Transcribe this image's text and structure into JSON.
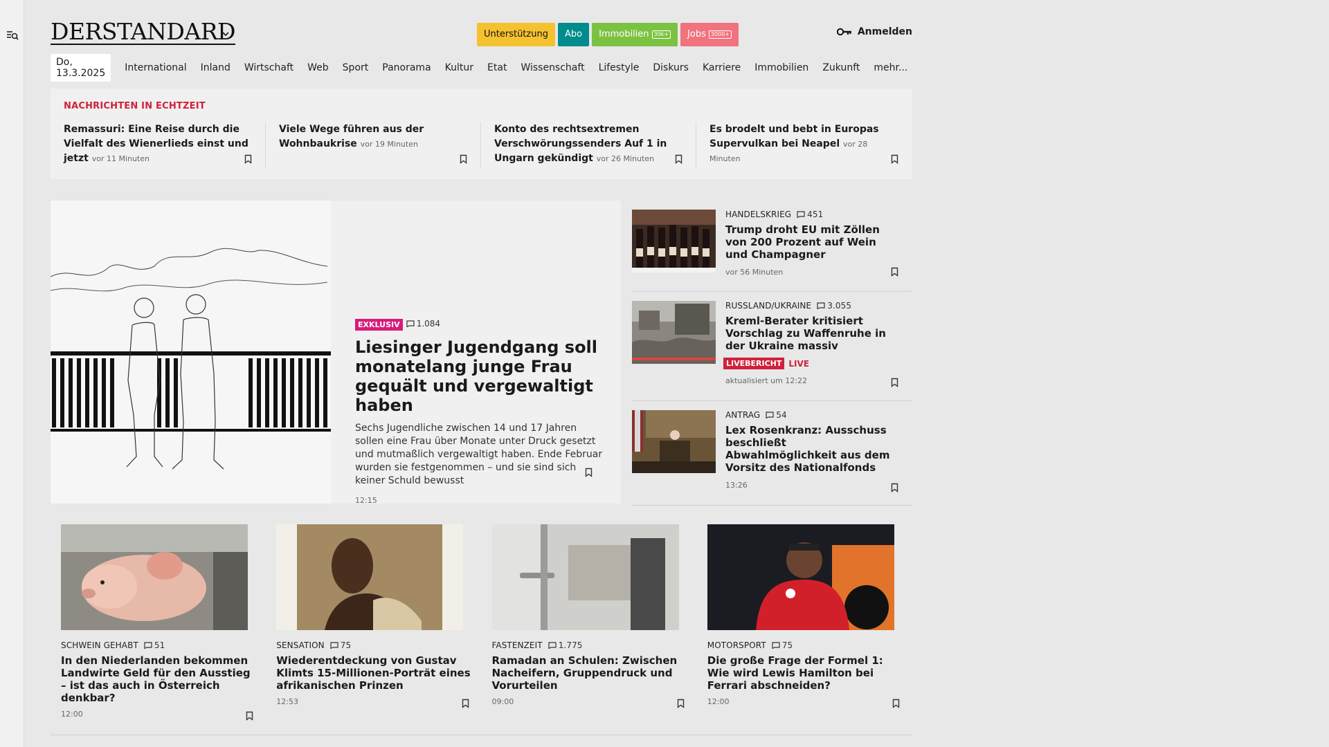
{
  "header": {
    "logo": "DERSTANDARD",
    "pills": [
      {
        "label": "Unterstützung",
        "bg": "#f5c22f",
        "color": "#111",
        "badge": ""
      },
      {
        "label": "Abo",
        "bg": "#008c8c",
        "color": "#fff",
        "badge": ""
      },
      {
        "label": "Immobilien",
        "bg": "#7cc242",
        "color": "#fff",
        "badge": "30k+"
      },
      {
        "label": "Jobs",
        "bg": "#f0737d",
        "color": "#fff",
        "badge": "3000+"
      }
    ],
    "login": "Anmelden"
  },
  "nav": {
    "date": "Do, 13.3.2025",
    "items": [
      "International",
      "Inland",
      "Wirtschaft",
      "Web",
      "Sport",
      "Panorama",
      "Kultur",
      "Etat",
      "Wissenschaft",
      "Lifestyle",
      "Diskurs",
      "Karriere",
      "Immobilien",
      "Zukunft",
      "mehr..."
    ]
  },
  "ticker": {
    "label": "NACHRICHTEN IN ECHTZEIT",
    "items": [
      {
        "title": "Remassuri: Eine Reise durch die Vielfalt des Wienerlieds einst und jetzt",
        "time": "vor 11 Minuten"
      },
      {
        "title": "Viele Wege führen aus der Wohnbaukrise",
        "time": "vor 19 Minuten"
      },
      {
        "title": "Konto des rechtsextremen Verschwörungssenders Auf 1 in Ungarn gekündigt",
        "time": "vor 26 Minuten"
      },
      {
        "title": "Es brodelt und bebt in Europas Supervulkan bei Neapel",
        "time": "vor 28 Minuten"
      }
    ]
  },
  "hero": {
    "tag": "EXKLUSIV",
    "comments": "1.084",
    "title": "Liesinger Jugendgang soll monatelang junge Frau gequält und vergewaltigt haben",
    "lead": "Sechs Jugendliche zwischen 14 und 17 Jahren sollen eine Frau über Monate unter Druck gesetzt und mutmaßlich vergewaltigt haben. Ende Februar wurden sie festgenommen – und sie sind sich keiner Schuld bewusst",
    "time": "12:15"
  },
  "side": [
    {
      "kicker": "HANDELSKRIEG",
      "comments": "451",
      "title": "Trump droht EU mit Zöllen von 200 Prozent auf Wein und Champagner",
      "time": "vor 56 Minuten"
    },
    {
      "kicker": "RUSSLAND/UKRAINE",
      "comments": "3.055",
      "title": "Kreml-Berater kritisiert Vorschlag zu Waffenruhe in der Ukraine massiv",
      "live_tag": "LIVEBERICHT",
      "live_text": "LIVE",
      "time": "aktualisiert um 12:22"
    },
    {
      "kicker": "ANTRAG",
      "comments": "54",
      "title": "Lex Rosenkranz: Ausschuss beschließt Abwahlmöglichkeit aus dem Vorsitz des Nationalfonds",
      "time": "13:26"
    }
  ],
  "teasers": [
    {
      "kicker": "SCHWEIN GEHABT",
      "comments": "51",
      "title": "In den Niederlanden bekommen Landwirte Geld für den Ausstieg – ist das auch in Österreich denkbar?",
      "time": "12:00"
    },
    {
      "kicker": "SENSATION",
      "comments": "75",
      "title": "Wiederentdeckung von Gustav Klimts 15-Millionen-Porträt eines afrikanischen Prinzen",
      "time": "12:53"
    },
    {
      "kicker": "FASTENZEIT",
      "comments": "1.775",
      "title": "Ramadan an Schulen: Zwischen Nacheifern, Gruppendruck und Vorurteilen",
      "time": "09:00"
    },
    {
      "kicker": "MOTORSPORT",
      "comments": "75",
      "title": "Die große Frage der Formel 1: Wie wird Lewis Hamilton bei Ferrari abschneiden?",
      "time": "12:00"
    }
  ]
}
